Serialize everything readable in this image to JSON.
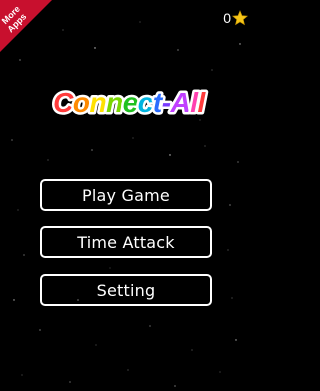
{
  "corner_banner": {
    "line1": "More",
    "line2": "Apps",
    "color": "#c8102e"
  },
  "score": {
    "value": "0",
    "icon": "star-icon",
    "star_color": "#f5c518"
  },
  "logo": {
    "text": "Connect-All",
    "letter_colors": [
      "#ff3b3b",
      "#ff8a00",
      "#ffe100",
      "#7ad600",
      "#20c020",
      "#00b4e0",
      "#2a6cff",
      "#7a3cff",
      "#c040ff",
      "#ff40b0",
      "#ff3b3b"
    ]
  },
  "menu": {
    "play_label": "Play Game",
    "time_label": "Time Attack",
    "setting_label": "Setting"
  }
}
